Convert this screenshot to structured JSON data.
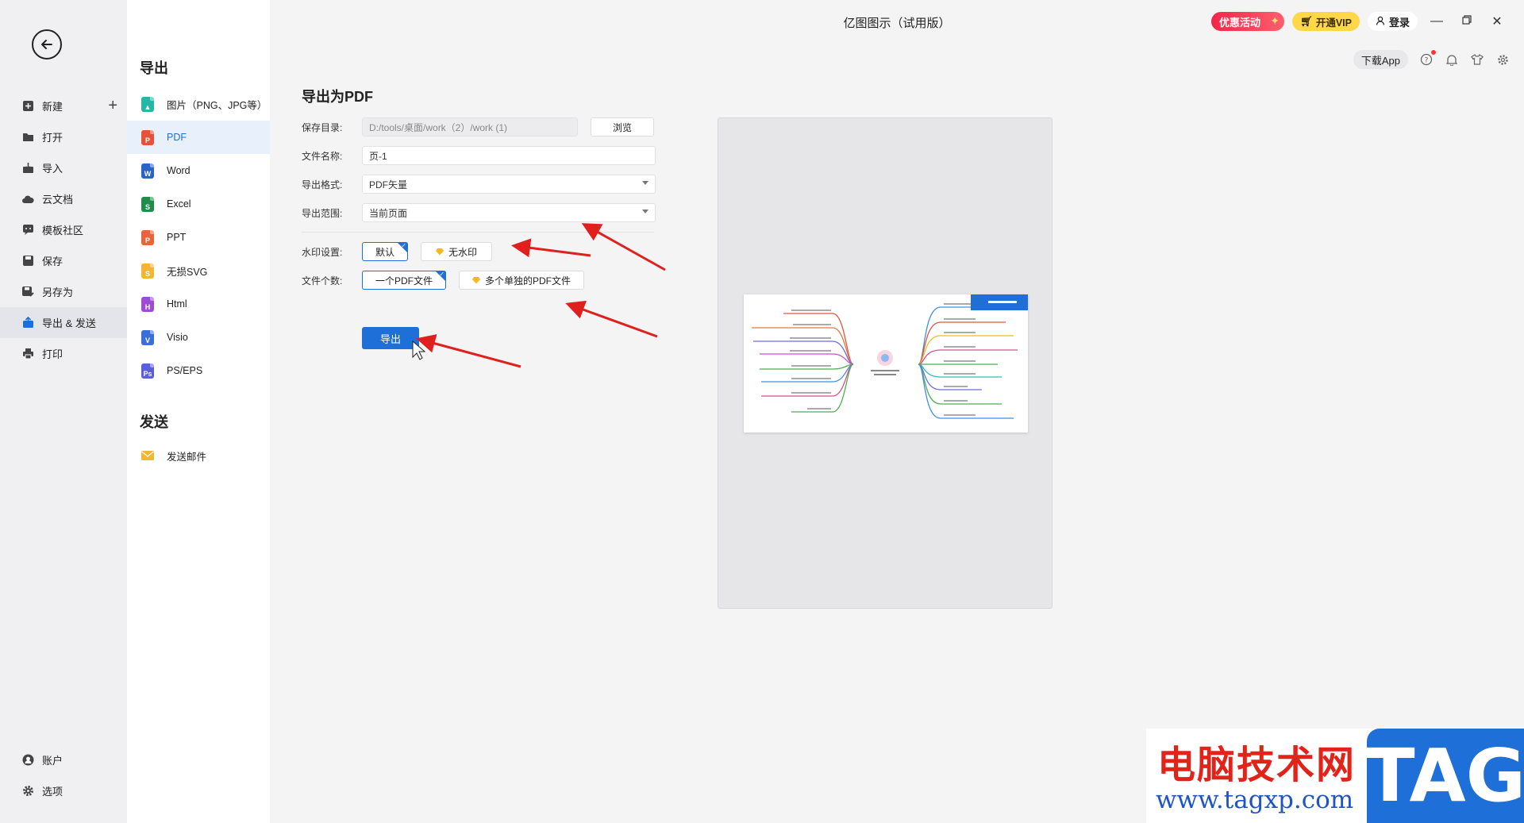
{
  "window": {
    "title": "亿图图示（试用版）"
  },
  "topbar": {
    "promo_label": "优惠活动",
    "vip_label": "开通VIP",
    "login_label": "登录",
    "download_app_label": "下载App"
  },
  "nav": {
    "items": [
      {
        "label": "新建"
      },
      {
        "label": "打开"
      },
      {
        "label": "导入"
      },
      {
        "label": "云文档"
      },
      {
        "label": "模板社区"
      },
      {
        "label": "保存"
      },
      {
        "label": "另存为"
      },
      {
        "label": "导出 & 发送"
      },
      {
        "label": "打印"
      }
    ],
    "bottom": [
      {
        "label": "账户"
      },
      {
        "label": "选项"
      }
    ]
  },
  "export_panel": {
    "export_heading": "导出",
    "formats": [
      {
        "label": "图片（PNG、JPG等）",
        "color": "#27b6a6"
      },
      {
        "label": "PDF",
        "color": "#e8503a"
      },
      {
        "label": "Word",
        "color": "#2b63c9"
      },
      {
        "label": "Excel",
        "color": "#1e8e4a"
      },
      {
        "label": "PPT",
        "color": "#e8643a"
      },
      {
        "label": "无损SVG",
        "color": "#f2b534"
      },
      {
        "label": "Html",
        "color": "#9b4dd8"
      },
      {
        "label": "Visio",
        "color": "#3a6fd8"
      },
      {
        "label": "PS/EPS",
        "color": "#5a5fd8"
      }
    ],
    "send_heading": "发送",
    "send_items": [
      {
        "label": "发送邮件",
        "color": "#f2b534"
      }
    ]
  },
  "form": {
    "title": "导出为PDF",
    "save_dir_label": "保存目录:",
    "save_dir_value": "D:/tools/桌面/work（2）/work (1)",
    "browse_label": "浏览",
    "filename_label": "文件名称:",
    "filename_value": "页-1",
    "format_label": "导出格式:",
    "format_value": "PDF矢量",
    "range_label": "导出范围:",
    "range_value": "当前页面",
    "watermark_label": "水印设置:",
    "watermark_options": [
      "默认",
      "无水印"
    ],
    "file_count_label": "文件个数:",
    "file_count_options": [
      "一个PDF文件",
      "多个单独的PDF文件"
    ],
    "export_button": "导出"
  },
  "watermark_overlay": {
    "site_name": "电脑技术网",
    "url": "www.tagxp.com",
    "tag": "TAG"
  },
  "colors": {
    "accent": "#1f6fd8",
    "arrow": "#e0201c"
  }
}
